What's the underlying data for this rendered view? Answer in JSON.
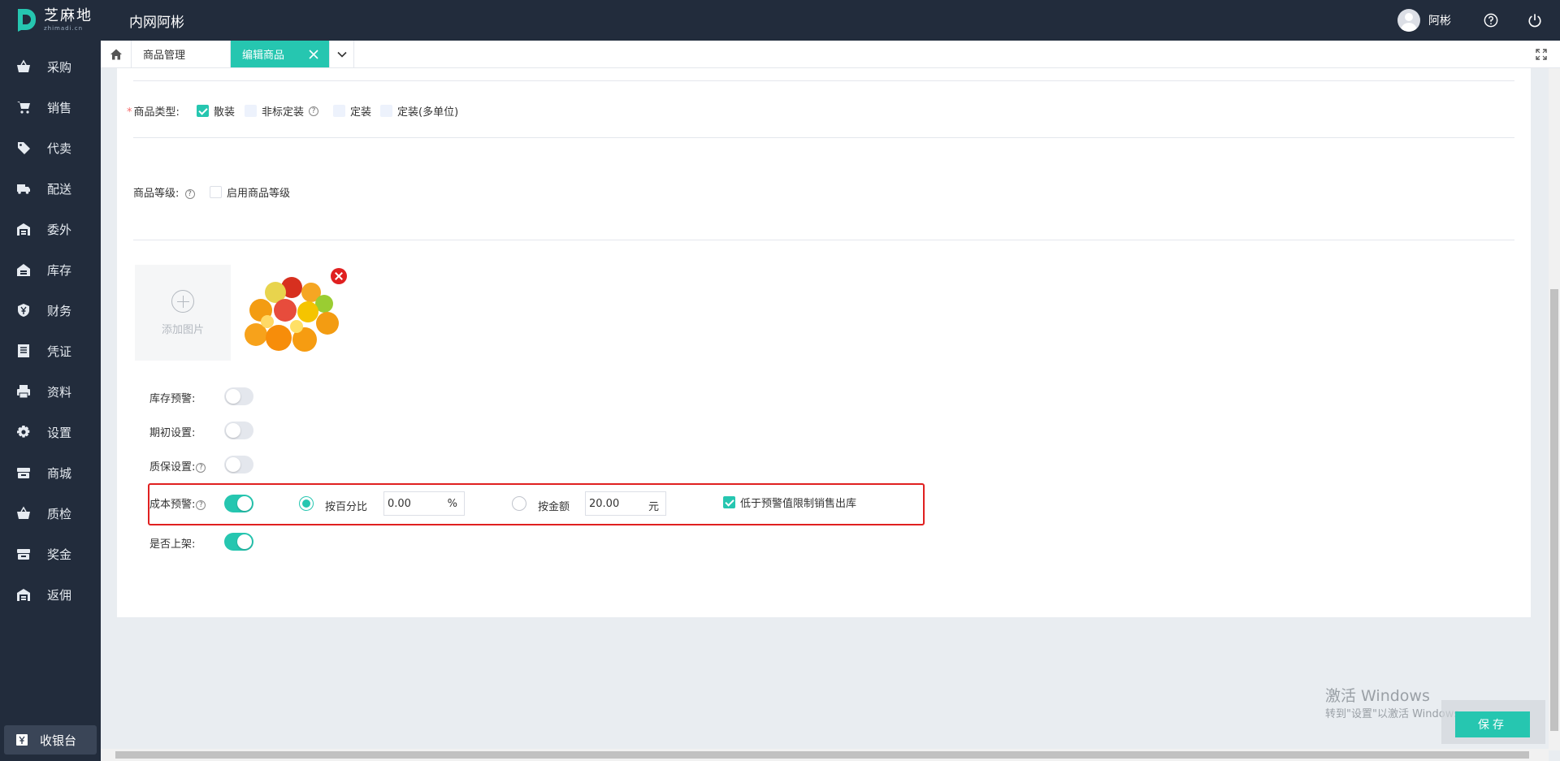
{
  "app": {
    "logo_text": "芝麻地",
    "logo_sub": "zhimadi.cn",
    "company": "内网阿彬",
    "username": "阿彬"
  },
  "sidebar": {
    "items": [
      {
        "label": "采购",
        "icon": "basket-icon"
      },
      {
        "label": "销售",
        "icon": "cart-icon"
      },
      {
        "label": "代卖",
        "icon": "tag-icon"
      },
      {
        "label": "配送",
        "icon": "truck-icon"
      },
      {
        "label": "委外",
        "icon": "warehouse-icon"
      },
      {
        "label": "库存",
        "icon": "house-icon"
      },
      {
        "label": "财务",
        "icon": "yuan-shield-icon"
      },
      {
        "label": "凭证",
        "icon": "document-icon"
      },
      {
        "label": "资料",
        "icon": "printer-icon"
      },
      {
        "label": "设置",
        "icon": "gear-icon"
      },
      {
        "label": "商城",
        "icon": "store-icon"
      },
      {
        "label": "质检",
        "icon": "basket-icon"
      },
      {
        "label": "奖金",
        "icon": "store-icon"
      },
      {
        "label": "返佣",
        "icon": "warehouse-icon"
      }
    ],
    "cashier": "收银台"
  },
  "tabs": {
    "items": [
      {
        "label": "商品管理"
      },
      {
        "label": "编辑商品"
      }
    ]
  },
  "form": {
    "product_type": {
      "label": "商品类型:",
      "options": [
        "散装",
        "非标定装",
        "定装",
        "定装(多单位)"
      ],
      "help": "?"
    },
    "grade": {
      "label": "商品等级:",
      "help": "?",
      "checkbox_label": "启用商品等级"
    },
    "upload": {
      "label": "添加图片"
    },
    "stock_warning": {
      "label": "库存预警:",
      "on": false
    },
    "initial_setting": {
      "label": "期初设置:",
      "on": false
    },
    "warranty": {
      "label": "质保设置:",
      "on": false,
      "help": "?"
    },
    "cost_warning": {
      "label": "成本预警:",
      "help": "?",
      "on": true,
      "radio_percent_label": "按百分比",
      "percent_value": "0.00",
      "percent_suffix": "%",
      "radio_amount_label": "按金额",
      "amount_value": "20.00",
      "amount_suffix": "元",
      "limit_label": "低于预警值限制销售出库"
    },
    "on_shelf": {
      "label": "是否上架:",
      "on": true
    }
  },
  "watermark": {
    "line1": "激活 Windows",
    "line2": "转到\"设置\"以激活 Windows。"
  },
  "actions": {
    "save_label": "保存"
  },
  "colors": {
    "header_bg": "#222c3c",
    "accent": "#26c6b0",
    "highlight_border": "#e02020"
  }
}
